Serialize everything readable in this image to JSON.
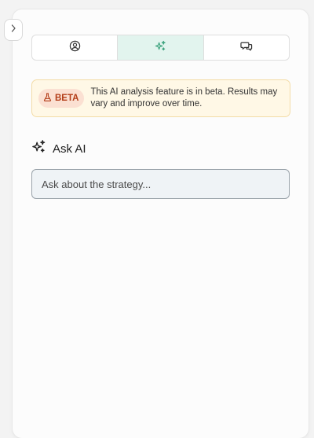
{
  "tabs": [
    {
      "icon": "user-circle-icon",
      "active": false
    },
    {
      "icon": "sparkle-icon",
      "active": true
    },
    {
      "icon": "chat-bubbles-icon",
      "active": false
    }
  ],
  "banner": {
    "badge": "BETA",
    "message": "This AI analysis feature is in beta. Results may vary and improve over time."
  },
  "ask": {
    "title": "Ask AI",
    "placeholder": "Ask about the strategy..."
  },
  "colors": {
    "accent": "#3aa27c",
    "active_tab_bg": "#e2f4ee",
    "banner_bg": "#fff8e6",
    "badge_bg": "#fbe0d2",
    "badge_text": "#b33d18"
  }
}
